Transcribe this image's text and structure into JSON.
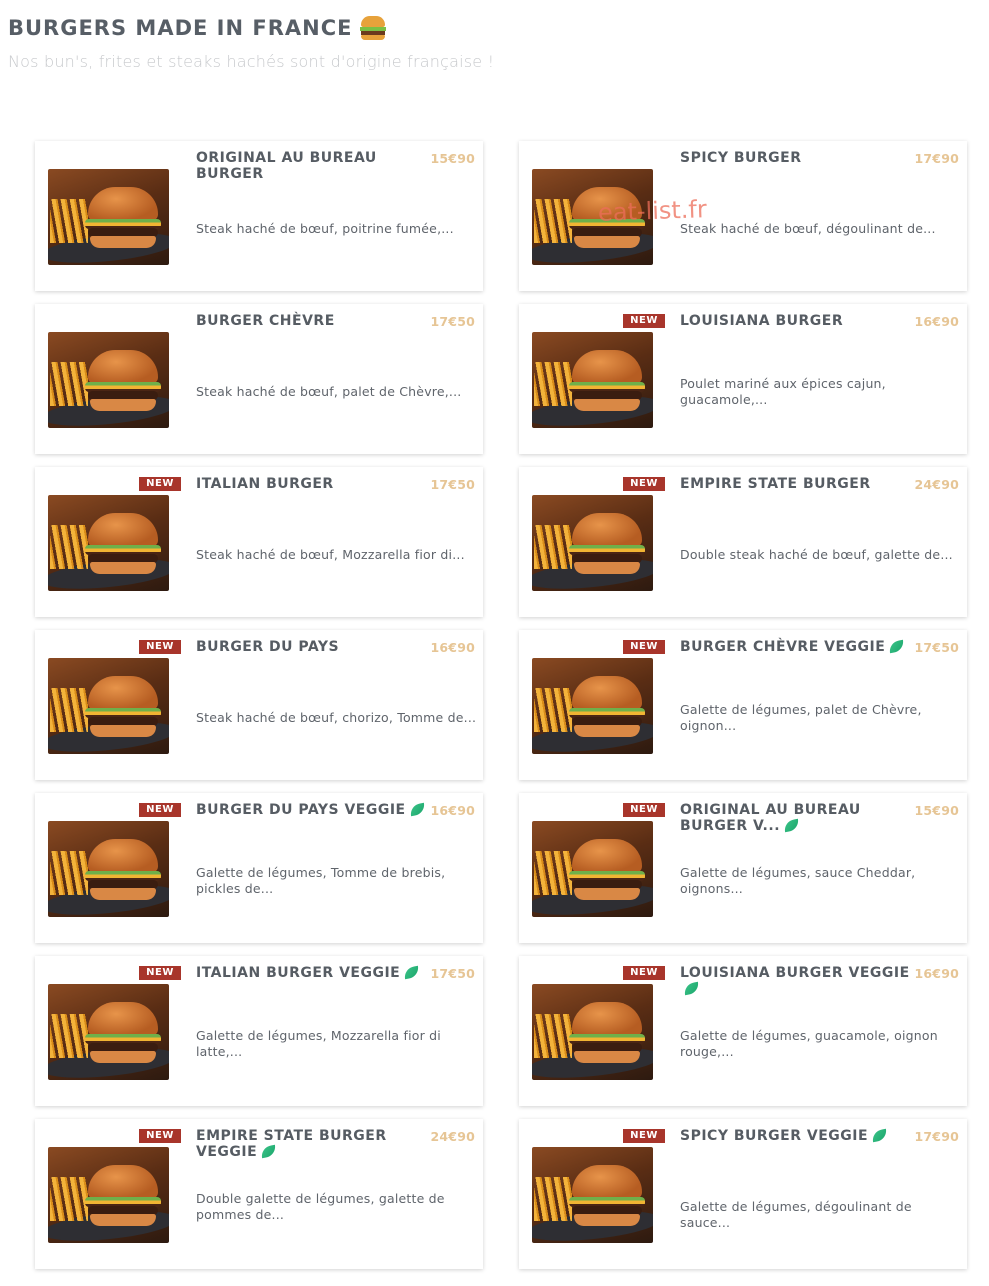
{
  "header": {
    "title": "BURGERS MADE IN FRANCE",
    "title_icon": "burger-emoji",
    "subtitle": "Nos bun's, frites et steaks hachés sont d'origine française !"
  },
  "watermark": "eat-list.fr",
  "colors": {
    "badge": "#a8352b",
    "price": "#e6c595",
    "veggie_leaf": "#2ab87a",
    "title": "#575e66"
  },
  "products": [
    {
      "name": "ORIGINAL AU BUREAU BURGER",
      "price": "15€90",
      "desc": "Steak haché de bœuf, poitrine fumée,...",
      "new": "",
      "veggie": false
    },
    {
      "name": "SPICY BURGER",
      "price": "17€90",
      "desc": "Steak haché de bœuf, dégoulinant de...",
      "new": "",
      "veggie": false
    },
    {
      "name": "BURGER CHÈVRE",
      "price": "17€50",
      "desc": "Steak haché de bœuf, palet de Chèvre,...",
      "new": "",
      "veggie": false
    },
    {
      "name": "LOUISIANA BURGER",
      "price": "16€90",
      "desc": "Poulet mariné aux épices cajun, guacamole,...",
      "new": "NEW",
      "veggie": false
    },
    {
      "name": "ITALIAN BURGER",
      "price": "17€50",
      "desc": "Steak haché de bœuf, Mozzarella fior di...",
      "new": "NEW",
      "veggie": false
    },
    {
      "name": "EMPIRE STATE BURGER",
      "price": "24€90",
      "desc": "Double steak haché de bœuf, galette de...",
      "new": "NEW",
      "veggie": false
    },
    {
      "name": "BURGER DU PAYS",
      "price": "16€90",
      "desc": "Steak haché de bœuf, chorizo, Tomme de...",
      "new": "NEW",
      "veggie": false
    },
    {
      "name": "BURGER CHÈVRE VEGGIE",
      "price": "17€50",
      "desc": "Galette de légumes, palet de Chèvre, oignon...",
      "new": "NEW",
      "veggie": true
    },
    {
      "name": "BURGER DU PAYS VEGGIE",
      "price": "16€90",
      "desc": "Galette de légumes, Tomme de brebis, pickles de...",
      "new": "NEW",
      "veggie": true
    },
    {
      "name": "ORIGINAL AU BUREAU BURGER V...",
      "price": "15€90",
      "desc": "Galette de légumes, sauce Cheddar, oignons...",
      "new": "NEW",
      "veggie": true
    },
    {
      "name": "ITALIAN BURGER VEGGIE",
      "price": "17€50",
      "desc": "Galette de légumes, Mozzarella fior di latte,...",
      "new": "NEW",
      "veggie": true
    },
    {
      "name": "LOUISIANA BURGER VEGGIE",
      "price": "16€90",
      "desc": "Galette de légumes, guacamole, oignon rouge,...",
      "new": "NEW",
      "veggie": true
    },
    {
      "name": "EMPIRE STATE BURGER VEGGIE",
      "price": "24€90",
      "desc": "Double galette de légumes, galette de pommes de...",
      "new": "NEW",
      "veggie": true
    },
    {
      "name": "SPICY BURGER VEGGIE",
      "price": "17€90",
      "desc": "Galette de légumes, dégoulinant de sauce...",
      "new": "NEW",
      "veggie": true
    }
  ]
}
